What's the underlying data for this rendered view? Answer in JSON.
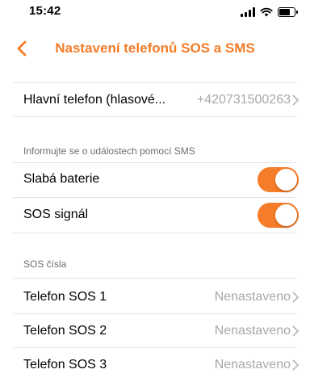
{
  "status_bar": {
    "time": "15:42",
    "icons": [
      "signal-icon",
      "wifi-icon",
      "battery-icon"
    ]
  },
  "nav": {
    "back_icon": "chevron-left-icon",
    "title": "Nastavení telefonů SOS a SMS"
  },
  "main_phone": {
    "label": "Hlavní telefon (hlasové...",
    "value": "+420731500263"
  },
  "sms_section": {
    "header": "Informujte se o událostech pomocí SMS",
    "items": [
      {
        "label": "Slabá baterie",
        "enabled": true
      },
      {
        "label": "SOS signál",
        "enabled": true
      }
    ]
  },
  "sos_section": {
    "header": "SOS čísla",
    "items": [
      {
        "label": "Telefon SOS 1",
        "value": "Nenastaveno"
      },
      {
        "label": "Telefon SOS 2",
        "value": "Nenastaveno"
      },
      {
        "label": "Telefon SOS 3",
        "value": "Nenastaveno"
      }
    ]
  },
  "colors": {
    "accent": "#f57c28",
    "secondary_text": "#a8a8ac",
    "separator": "#e3e3e5"
  }
}
